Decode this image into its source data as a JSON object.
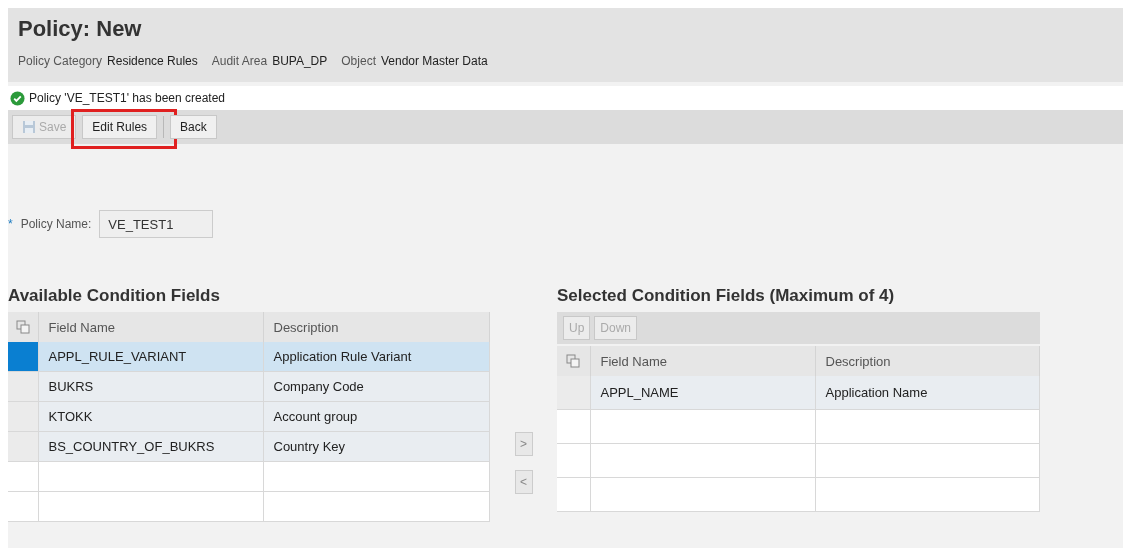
{
  "page": {
    "title": "Policy: New"
  },
  "meta": [
    {
      "label": "Policy Category",
      "value": "Residence Rules"
    },
    {
      "label": "Audit Area",
      "value": "BUPA_DP"
    },
    {
      "label": "Object",
      "value": "Vendor Master Data"
    }
  ],
  "message": {
    "kind": "success",
    "text": "Policy 'VE_TEST1' has been created"
  },
  "toolbar": [
    {
      "label": "Save",
      "kind": "save",
      "disabled": true,
      "highlighted": false
    },
    {
      "label": "Edit Rules",
      "kind": "plain",
      "disabled": false,
      "highlighted": true
    },
    {
      "label": "Back",
      "kind": "plain",
      "disabled": false,
      "highlighted": false
    }
  ],
  "policy_name": {
    "required_mark": "*",
    "label": "Policy Name:",
    "value": "VE_TEST1"
  },
  "available": {
    "title": "Available Condition Fields",
    "columns": [
      "Field Name",
      "Description"
    ],
    "rows": [
      {
        "cells": [
          "APPL_RULE_VARIANT",
          "Application Rule Variant"
        ],
        "selected": true
      },
      {
        "cells": [
          "BUKRS",
          "Company Code"
        ],
        "selected": false
      },
      {
        "cells": [
          "KTOKK",
          "Account group"
        ],
        "selected": false
      },
      {
        "cells": [
          "BS_COUNTRY_OF_BUKRS",
          "Country Key"
        ],
        "selected": false
      }
    ]
  },
  "move_buttons": [
    {
      "label": ">",
      "disabled": true
    },
    {
      "label": "<",
      "disabled": true
    }
  ],
  "selected_fields": {
    "title": "Selected Condition Fields (Maximum of 4)",
    "toolbar": [
      {
        "label": "Up",
        "disabled": true
      },
      {
        "label": "Down",
        "disabled": true
      }
    ],
    "columns": [
      "Field Name",
      "Description"
    ],
    "rows": [
      {
        "cells": [
          "APPL_NAME",
          "Application Name"
        ],
        "selected": false
      }
    ]
  }
}
